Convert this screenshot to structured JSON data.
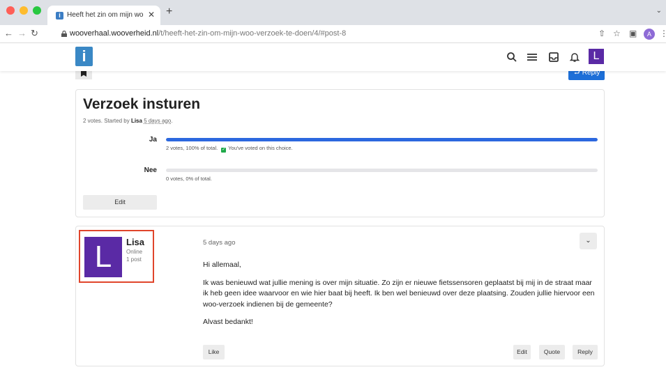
{
  "browser": {
    "tab_title": "Heeft het zin om mijn woo-ver",
    "tab_favicon": "i",
    "url_host": "wooverhaal.wooverheid.nl",
    "url_path": "/t/heeft-het-zin-om-mijn-woo-verzoek-te-doen/4/#post-8",
    "profile_initial": "A"
  },
  "header": {
    "logo_letter": "i",
    "user_initial": "L",
    "icons": [
      "search-icon",
      "hamburger-icon",
      "inbox-icon",
      "bell-icon"
    ]
  },
  "topbar": {
    "reply_label": "Reply"
  },
  "poll": {
    "title": "Verzoek insturen",
    "meta_prefix": "2 votes.  Started by ",
    "meta_author": "Lisa",
    "meta_time": "5 days ago",
    "meta_suffix": ".",
    "choices": [
      {
        "label": "Ja",
        "percent": 100,
        "info": "2 votes, 100% of total.",
        "voted_text": "You've voted on this choice."
      },
      {
        "label": "Nee",
        "percent": 0,
        "info": "0 votes, 0% of total.",
        "voted_text": ""
      }
    ],
    "edit_label": "Edit"
  },
  "post": {
    "author": "Lisa",
    "avatar_initial": "L",
    "status": "Online",
    "post_count": "1 post",
    "time": "5 days ago",
    "body": [
      "Hi allemaal,",
      "Ik was benieuwd wat jullie mening is over mijn situatie. Zo zijn er nieuwe fietssensoren geplaatst bij mij in de straat maar ik heb geen idee waarvoor en wie hier baat bij heeft. Ik ben wel benieuwd over deze plaatsing. Zouden jullie hiervoor een woo-verzoek indienen bij de gemeente?",
      "Alvast bedankt!"
    ],
    "like_label": "Like",
    "edit_label": "Edit",
    "quote_label": "Quote",
    "reply_label": "Reply"
  },
  "colors": {
    "brand_blue": "#3a88c5",
    "avatar_purple": "#5a2aa5",
    "poll_bar": "#2c68df",
    "highlight_red": "#e0452b"
  }
}
